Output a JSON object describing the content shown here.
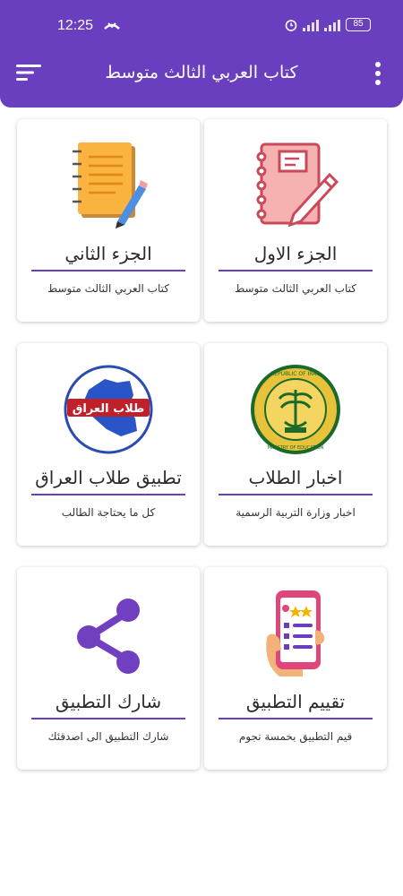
{
  "status_bar": {
    "time": "12:25",
    "battery": "85"
  },
  "app_bar": {
    "title": "كتاب العربي الثالث متوسط"
  },
  "cards": [
    {
      "title": "الجزء الاول",
      "subtitle": "كتاب العربي الثالث متوسط",
      "icon": "notebook-pencil-icon"
    },
    {
      "title": "الجزء الثاني",
      "subtitle": "كتاب العربي الثالث متوسط",
      "icon": "notepad-pencil-icon"
    },
    {
      "title": "اخبار الطلاب",
      "subtitle": "اخبار وزارة التربية الرسمية",
      "icon": "ministry-emblem-icon",
      "emblem_top": "REPUBLIC OF IRAQ",
      "emblem_bottom": "MINISTRY OF EDUCATION"
    },
    {
      "title": "تطبيق طلاب العراق",
      "subtitle": "كل ما يحتاجة الطالب",
      "icon": "iraq-map-logo-icon",
      "logo_text": "طلاب العراق"
    },
    {
      "title": "تقييم التطبيق",
      "subtitle": "قيم التطبيق بخمسة نجوم",
      "icon": "phone-rating-icon"
    },
    {
      "title": "شارك التطبيق",
      "subtitle": "شارك التطبيق الى اصدقئك",
      "icon": "share-icon"
    }
  ],
  "colors": {
    "primary": "#6a3fbf",
    "accent_rule": "#6a3fbf",
    "card_bg": "#ffffff"
  }
}
